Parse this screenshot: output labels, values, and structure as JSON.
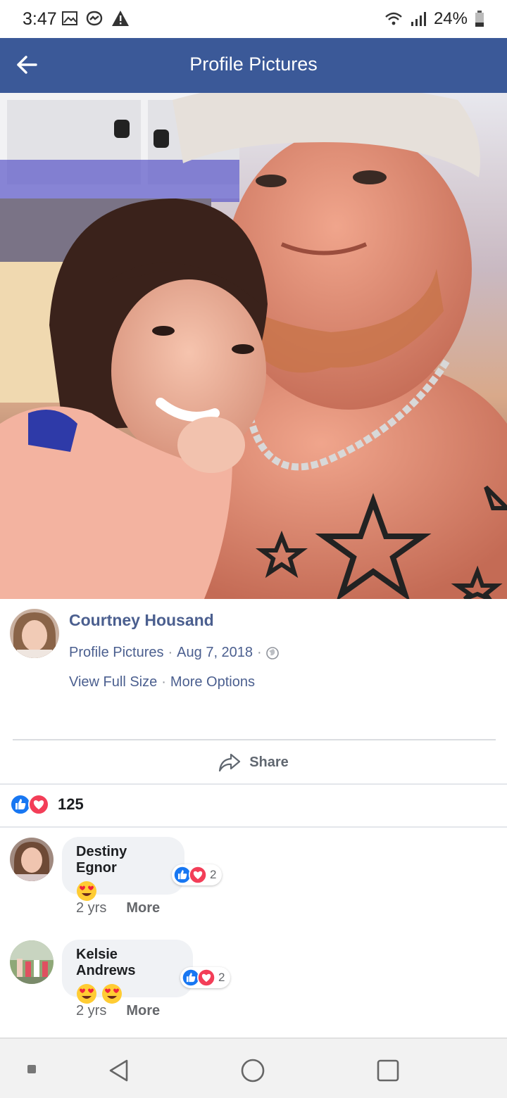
{
  "status_bar": {
    "time": "3:47",
    "battery": "24%",
    "icons": [
      "image-icon",
      "messenger-icon",
      "warning-icon",
      "wifi-icon",
      "signal-icon",
      "battery-icon"
    ]
  },
  "app_bar": {
    "title": "Profile Pictures",
    "background": "#3b5998"
  },
  "post": {
    "author": "Courtney Housand",
    "album": "Profile Pictures",
    "date": "Aug 7, 2018",
    "view_full_size": "View Full Size",
    "more_options": "More Options",
    "share_label": "Share",
    "reaction_count": "125"
  },
  "comments": [
    {
      "name": "Destiny Egnor",
      "emoji": [
        "😍"
      ],
      "reaction_count": "2",
      "time": "2 yrs",
      "more": "More"
    },
    {
      "name": "Kelsie Andrews",
      "emoji": [
        "😍",
        "😍"
      ],
      "reaction_count": "2",
      "time": "2 yrs",
      "more": "More"
    }
  ],
  "colors": {
    "like_blue": "#1877f2",
    "love_red": "#f33e58",
    "link_blue": "#4b5f8f"
  }
}
